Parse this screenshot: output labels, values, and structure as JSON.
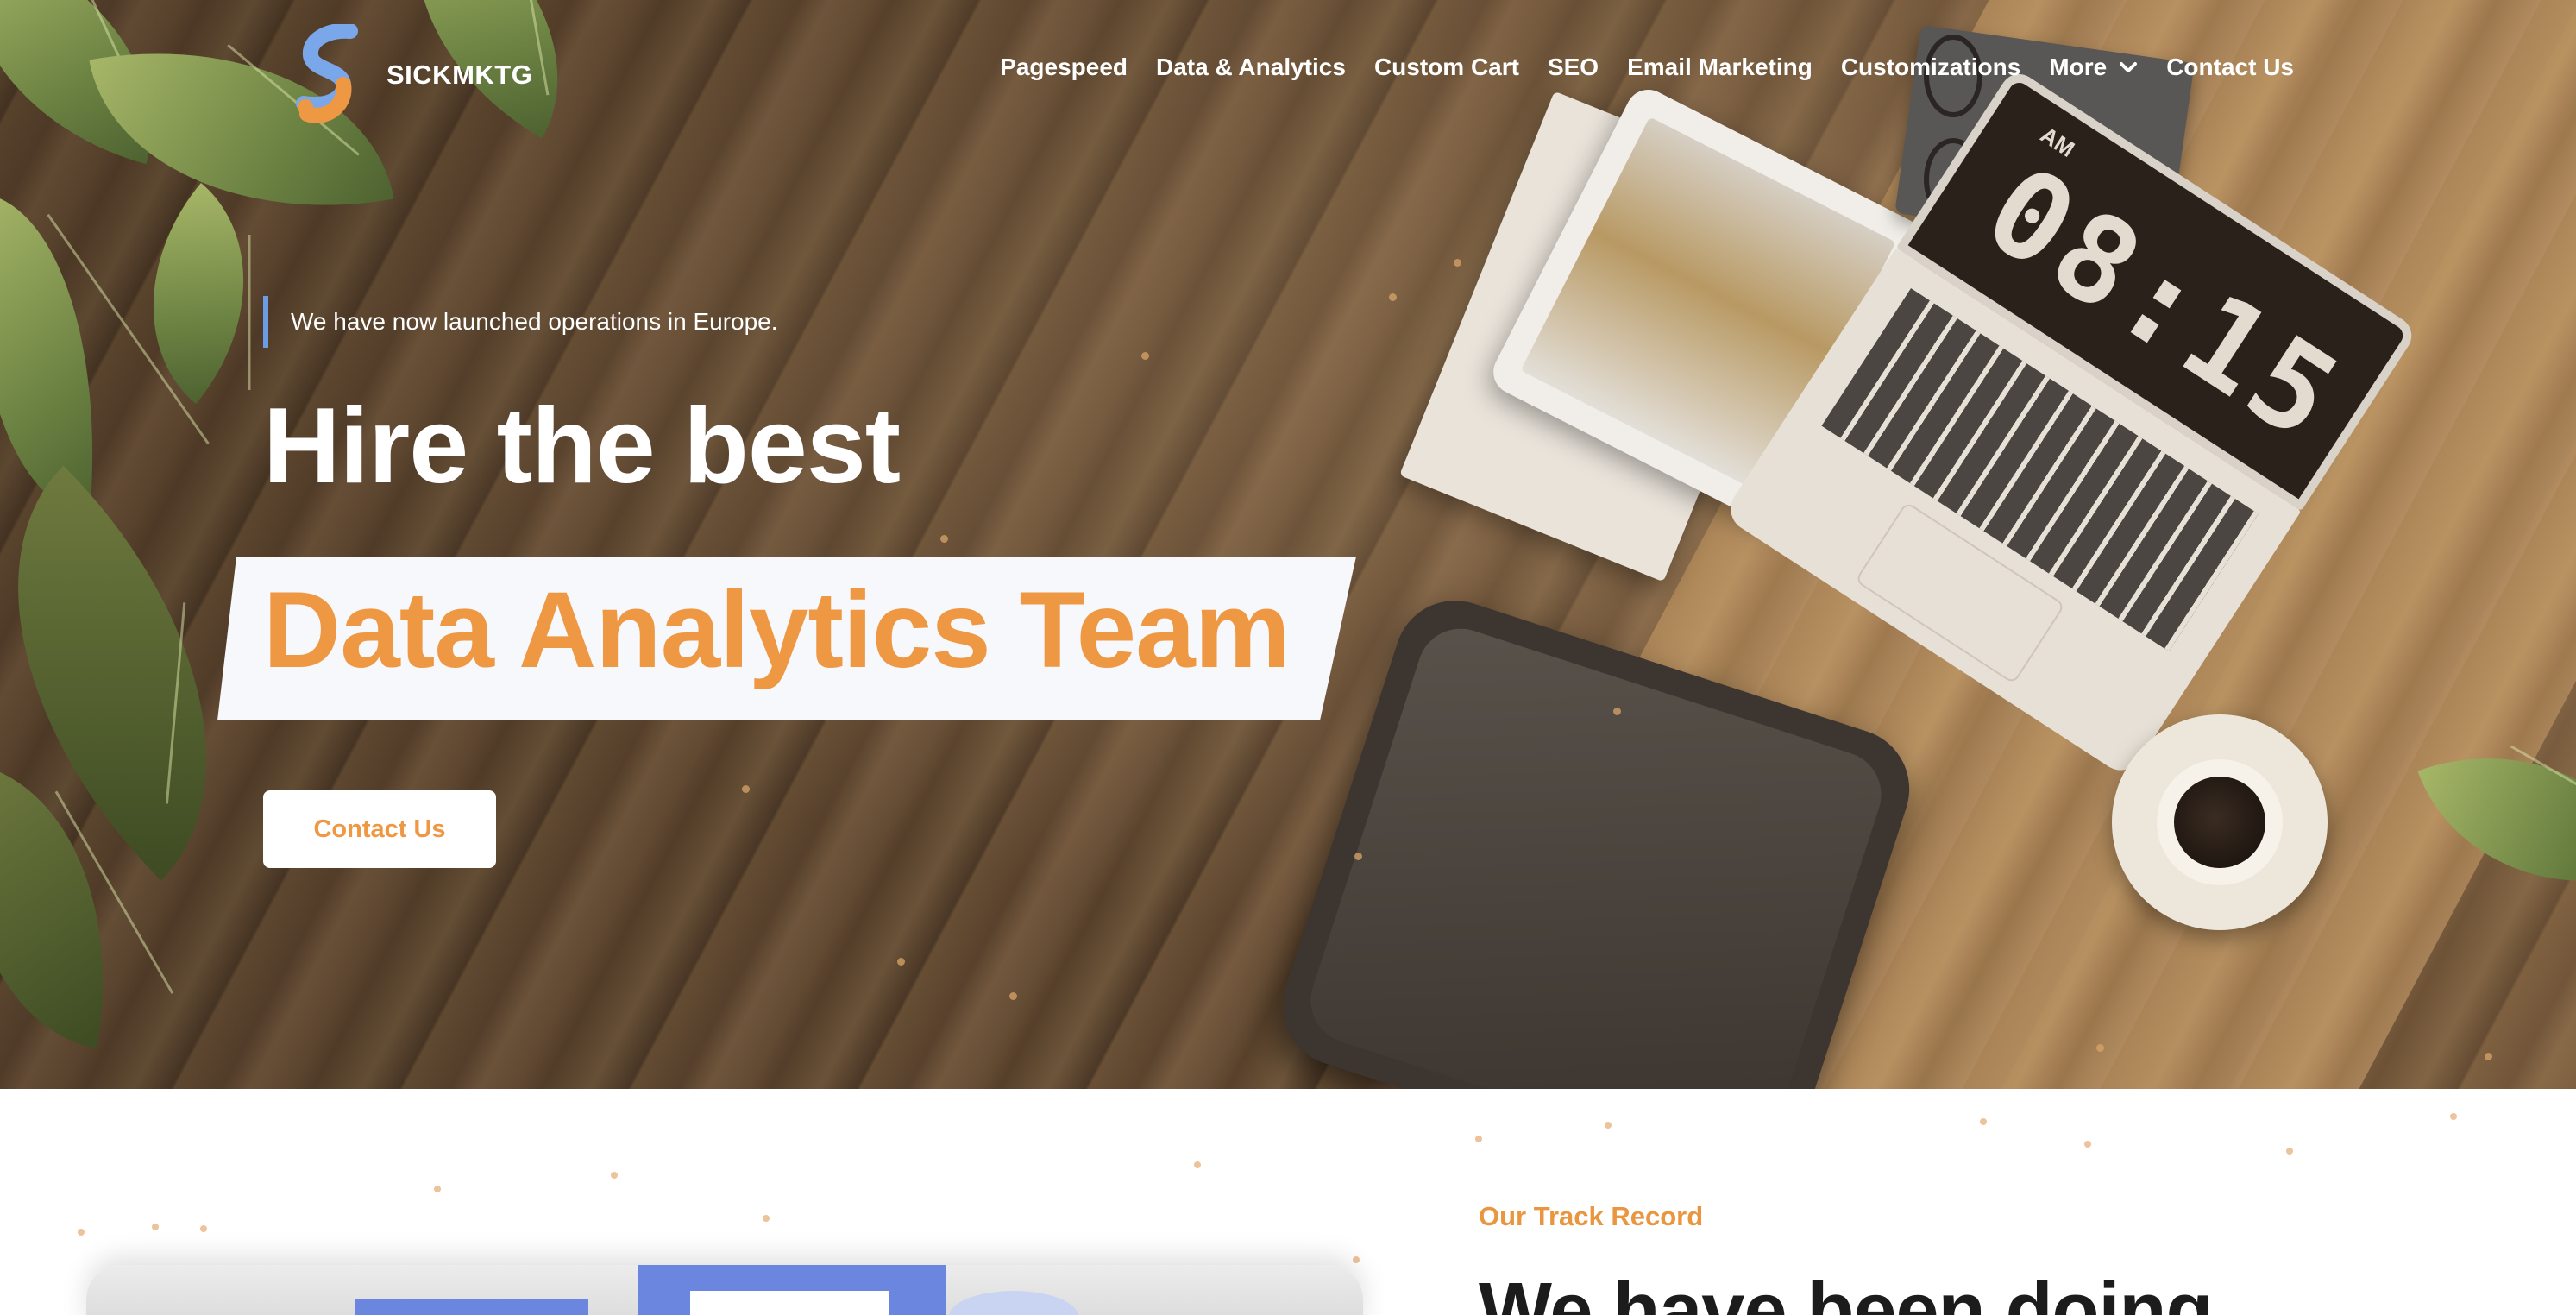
{
  "brand": {
    "name": "SICKMKTG",
    "colors": {
      "blue": "#6d9ce6",
      "orange": "#ef9843"
    }
  },
  "nav": {
    "items": [
      {
        "label": "Pagespeed"
      },
      {
        "label": "Data & Analytics"
      },
      {
        "label": "Custom Cart"
      },
      {
        "label": "SEO"
      },
      {
        "label": "Email Marketing"
      },
      {
        "label": "Customizations"
      },
      {
        "label": "More",
        "icon": "chevron-down-icon"
      },
      {
        "label": "Contact Us"
      }
    ]
  },
  "hero": {
    "announcement": "We have now launched operations in Europe.",
    "headline": "Hire the best",
    "highlight": "Data Analytics Team",
    "cta_label": "Contact Us",
    "clock": {
      "am": "AM",
      "time": "08:15"
    }
  },
  "track_record": {
    "label": "Our Track Record",
    "heading": "We have been doing"
  }
}
